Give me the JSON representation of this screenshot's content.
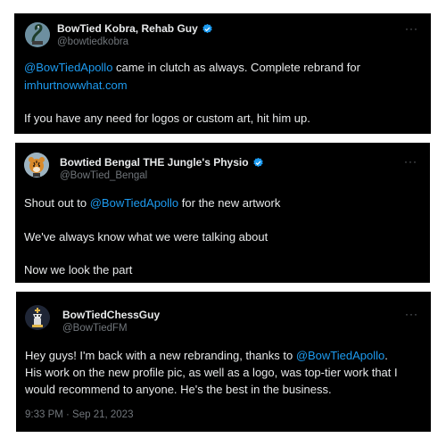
{
  "colors": {
    "card_background": "#000000",
    "text": "#e7e9ea",
    "secondary_text": "#71767b",
    "link": "#1d9bf0",
    "verified_badge": "#1d9bf0"
  },
  "tweets": [
    {
      "author_name": "BowTied Kobra, Rehab Guy",
      "handle": "@bowtiedkobra",
      "verified": true,
      "avatar_icon": "cobra-avatar",
      "more_label": "···",
      "lines": {
        "l1_mention": "@BowTiedApollo",
        "l1_text": " came in clutch as always. Complete rebrand for",
        "l2_link": "imhurtnowwhat.com",
        "l3_text": "If you have any need for logos or custom art, hit him up."
      }
    },
    {
      "author_name": "Bowtied Bengal THE Jungle's Physio",
      "handle": "@BowTied_Bengal",
      "verified": true,
      "avatar_icon": "tiger-avatar",
      "more_label": "···",
      "lines": {
        "l1_prefix": "Shout out to ",
        "l1_mention": "@BowTiedApollo",
        "l1_suffix": " for the new artwork",
        "l2_text": "We've always know what we were talking about",
        "l3_text": "Now we look the part"
      }
    },
    {
      "author_name": "BowTiedChessGuy",
      "handle": "@BowTiedFM",
      "verified": false,
      "avatar_icon": "chess-king-avatar",
      "more_label": "···",
      "lines": {
        "l1_prefix": "Hey guys! I'm back with a new rebranding, thanks to ",
        "l1_mention": "@BowTiedApollo",
        "l1_suffix": ".",
        "l2_text": "His work on the new profile pic, as well as a logo, was top-tier work that I",
        "l3_text": "would recommend to anyone. He's the best in the business."
      },
      "timestamp": "9:33 PM · Sep 21, 2023"
    }
  ]
}
